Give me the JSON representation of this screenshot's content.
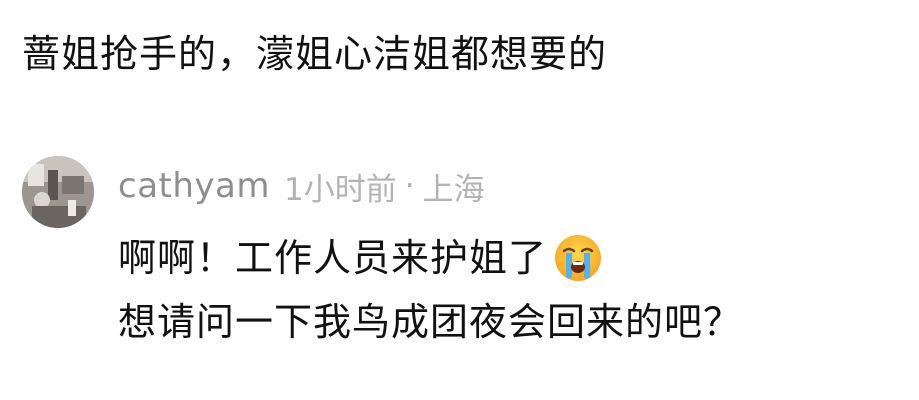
{
  "comment": {
    "text": "蔷姐抢手的，濛姐心洁姐都想要的"
  },
  "reply": {
    "username": "cathyam",
    "time": "1小时前",
    "separator": "·",
    "location": "上海",
    "line1": "啊啊！工作人员来护姐了",
    "line1_emoji": "loudly-crying-face-icon",
    "line2": "想请问一下我鸟成团夜会回来的吧？"
  }
}
